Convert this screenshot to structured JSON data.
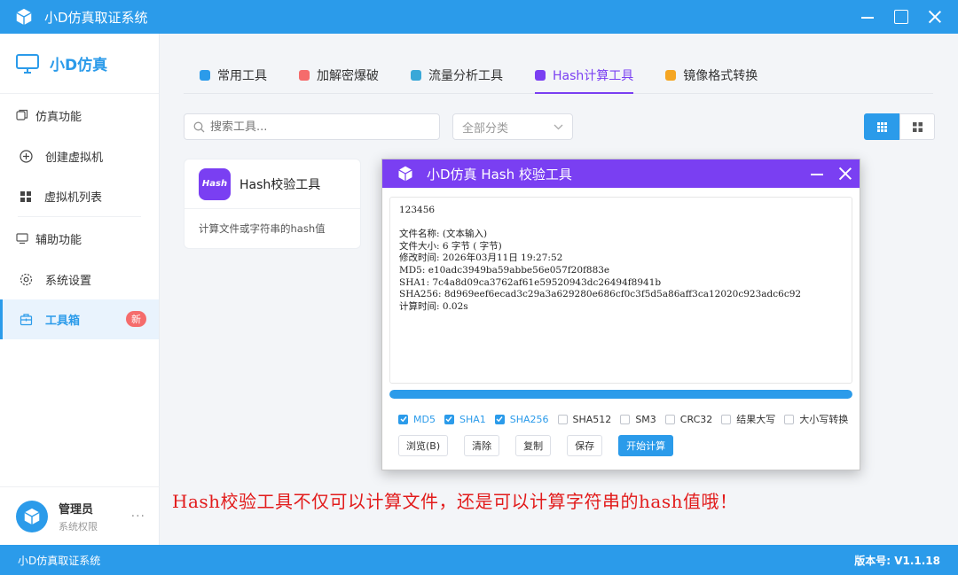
{
  "window": {
    "title": "小D仿真取证系统"
  },
  "sidebar": {
    "brand": "小D仿真",
    "section1": "仿真功能",
    "item_create_vm": "创建虚拟机",
    "item_vm_list": "虚拟机列表",
    "section2": "辅助功能",
    "item_settings": "系统设置",
    "item_toolbox": "工具箱",
    "toolbox_badge": "新",
    "user_name": "管理员",
    "user_role": "系统权限",
    "more": "···"
  },
  "tabs": [
    "常用工具",
    "加解密爆破",
    "流量分析工具",
    "Hash计算工具",
    "镜像格式转换"
  ],
  "tab_colors": [
    "#2b9bea",
    "#f56c6c",
    "#3aa8d8",
    "#7a3ff2",
    "#f5a623"
  ],
  "active_tab": 3,
  "search": {
    "placeholder": "搜索工具..."
  },
  "category": {
    "selected": "全部分类"
  },
  "tool_card": {
    "logo": "Hash",
    "name": "Hash校验工具",
    "description": "计算文件或字符串的hash值"
  },
  "dialog": {
    "title": "小D仿真 Hash 校验工具",
    "output_lines": [
      "123456",
      "",
      "文件名称: (文本输入)",
      "文件大小: 6 字节 ( 字节)",
      "修改时间: 2026年03月11日 19:27:52",
      "MD5: e10adc3949ba59abbe56e057f20f883e",
      "SHA1: 7c4a8d09ca3762af61e59520943dc26494f8941b",
      "SHA256: 8d969eef6ecad3c29a3a629280e686cf0c3f5d5a86aff3ca12020c923adc6c92",
      "计算时间: 0.02s"
    ],
    "progress": 1.0,
    "options": [
      {
        "label": "MD5",
        "checked": true
      },
      {
        "label": "SHA1",
        "checked": true
      },
      {
        "label": "SHA256",
        "checked": true
      },
      {
        "label": "SHA512",
        "checked": false
      },
      {
        "label": "SM3",
        "checked": false
      },
      {
        "label": "CRC32",
        "checked": false
      },
      {
        "label": "结果大写",
        "checked": false
      },
      {
        "label": "大小写转换",
        "checked": false
      }
    ],
    "buttons": {
      "browse": "浏览(B)",
      "clear": "清除",
      "copy": "复制",
      "save": "保存",
      "start": "开始计算"
    }
  },
  "caption": "Hash校验工具不仅可以计算文件，还是可以计算字符串的hash值哦！",
  "statusbar": {
    "left": "小D仿真取证系统",
    "version": "版本号: V1.1.18"
  },
  "colors": {
    "primary": "#2b9bea",
    "purple": "#7a3ff2",
    "red": "#e21b1b"
  }
}
